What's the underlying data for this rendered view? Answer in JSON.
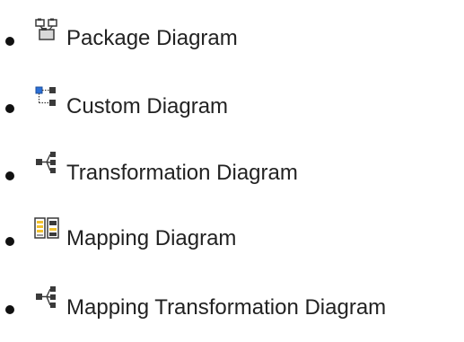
{
  "items": [
    {
      "label": "Package Diagram",
      "icon": "package-diagram-icon"
    },
    {
      "label": "Custom Diagram",
      "icon": "custom-diagram-icon"
    },
    {
      "label": "Transformation Diagram",
      "icon": "transformation-diagram-icon"
    },
    {
      "label": "Mapping Diagram",
      "icon": "mapping-diagram-icon"
    },
    {
      "label": "Mapping Transformation Diagram",
      "icon": "mapping-transformation-diagram-icon"
    }
  ],
  "colors": {
    "text": "#222222",
    "bullet": "#111111",
    "icon_dark": "#3a3a3a",
    "icon_blue": "#2b6fd6",
    "icon_yellow": "#f2c12e",
    "icon_gray": "#9a9a9a"
  }
}
